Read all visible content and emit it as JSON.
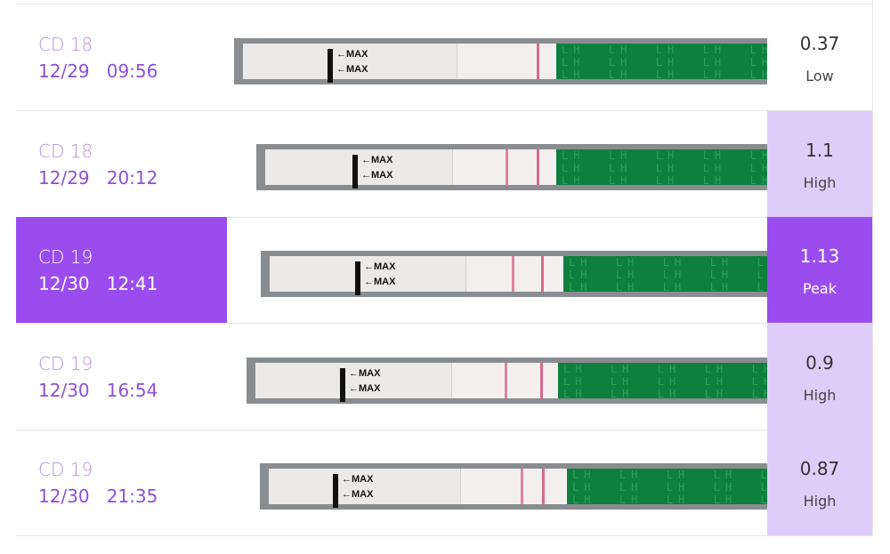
{
  "colors": {
    "accent": "#9b4cef",
    "accent_light": "#dfcdf9",
    "date_text": "#8f4fd6",
    "cycle_day_text": "#b491dc",
    "strip_green": "#0f7f3e",
    "test_line": "#d66a8b"
  },
  "strip_marking": "MAX",
  "strip_pad_text": "LH",
  "rows": [
    {
      "cycle_day": "CD 18",
      "date": "12/29",
      "time": "09:56",
      "value": "0.37",
      "level": "Low",
      "selected": false
    },
    {
      "cycle_day": "CD 18",
      "date": "12/29",
      "time": "20:12",
      "value": "1.1",
      "level": "High",
      "selected": false
    },
    {
      "cycle_day": "CD 19",
      "date": "12/30",
      "time": "12:41",
      "value": "1.13",
      "level": "Peak",
      "selected": true
    },
    {
      "cycle_day": "CD 19",
      "date": "12/30",
      "time": "16:54",
      "value": "0.9",
      "level": "High",
      "selected": false
    },
    {
      "cycle_day": "CD 19",
      "date": "12/30",
      "time": "21:35",
      "value": "0.87",
      "level": "High",
      "selected": false
    }
  ]
}
